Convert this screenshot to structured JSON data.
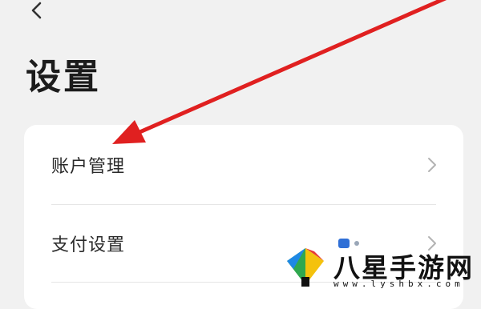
{
  "header": {
    "back_icon": "chevron-left-icon",
    "title": "设置"
  },
  "settings_card": {
    "items": [
      {
        "label": "账户管理",
        "icon": "chevron-right-icon"
      },
      {
        "label": "支付设置",
        "icon": "chevron-right-icon"
      }
    ]
  },
  "annotation": {
    "arrow_color": "#e02020"
  },
  "watermark": {
    "site_name": "八星手游网",
    "url": "www.lyshbx.com"
  },
  "colors": {
    "background": "#f1f1f1",
    "card": "#ffffff",
    "accent": "#2f6fd6"
  }
}
